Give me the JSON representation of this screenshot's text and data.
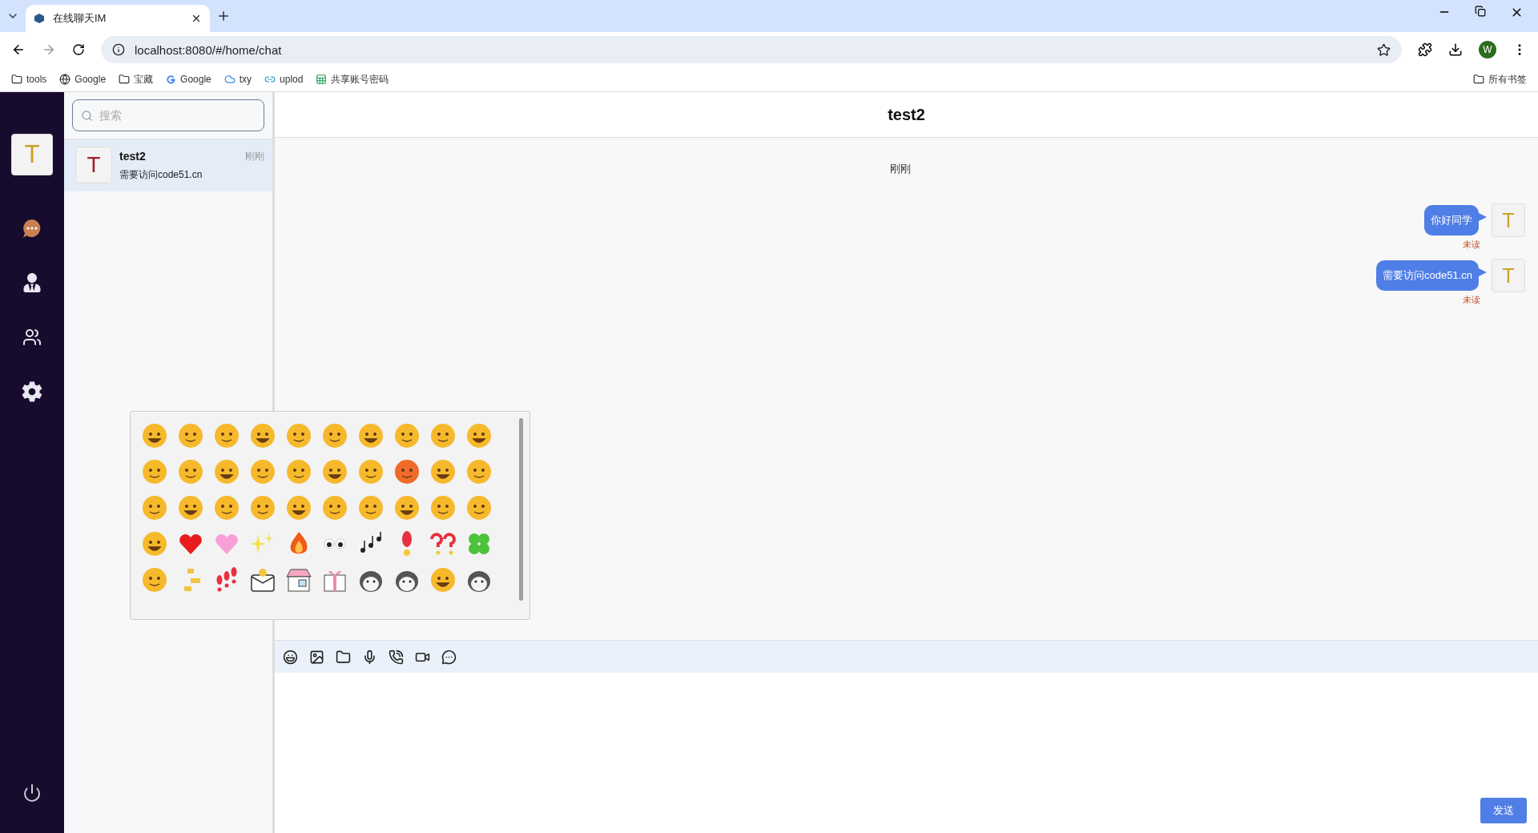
{
  "browser": {
    "tab_title": "在线聊天IM",
    "url": "localhost:8080/#/home/chat",
    "bookmarks": [
      {
        "kind": "folder",
        "label": "tools"
      },
      {
        "kind": "globe",
        "label": "Google"
      },
      {
        "kind": "folder",
        "label": "宝藏"
      },
      {
        "kind": "google",
        "label": "Google"
      },
      {
        "kind": "cloud",
        "label": "txy"
      },
      {
        "kind": "link",
        "label": "uplod"
      },
      {
        "kind": "sheet",
        "label": "共享账号密码"
      }
    ],
    "all_bookmarks": "所有书签",
    "profile": "W"
  },
  "nav": {
    "avatar": "T",
    "items": [
      {
        "kind": "chat",
        "selected": true
      },
      {
        "kind": "contacts",
        "selected": false
      },
      {
        "kind": "groups",
        "selected": false
      },
      {
        "kind": "settings",
        "selected": false
      }
    ]
  },
  "search": {
    "placeholder": "搜索"
  },
  "conversations": [
    {
      "avatar": "T",
      "name": "test2",
      "time": "刚刚",
      "preview": "需要访问code51.cn",
      "selected": true
    }
  ],
  "chat": {
    "title": "test2",
    "time_divider": "刚刚",
    "messages": [
      {
        "text": "你好同学",
        "status": "未读",
        "avatar": "T"
      },
      {
        "text": "需要访问code51.cn",
        "status": "未读",
        "avatar": "T"
      }
    ],
    "send_button": "发送"
  },
  "emoji_picker": {
    "open": true
  }
}
